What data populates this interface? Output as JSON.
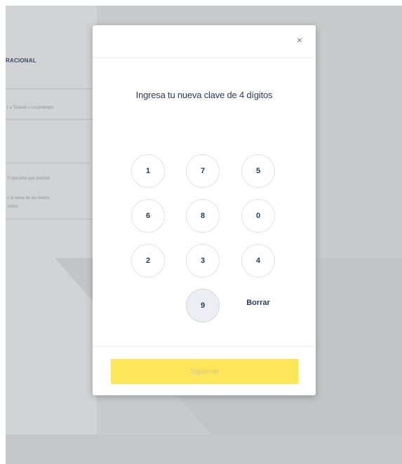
{
  "background": {
    "title": "RACIONAL",
    "subtitle": "",
    "line1": "r a Tisanal o cocumentos",
    "line2": "Ti porsona que precise",
    "line3": "s la tarea de las banco",
    "line4": "ssitus"
  },
  "modal": {
    "close_icon": "close-icon",
    "close_glyph": "×",
    "title": "Ingresa tu nueva clave de 4 dígitos",
    "keypad": {
      "rows": [
        [
          "1",
          "7",
          "5"
        ],
        [
          "6",
          "8",
          "0"
        ],
        [
          "2",
          "3",
          "4"
        ]
      ],
      "last_key": "9",
      "delete_label": "Borrar"
    },
    "continue_label": "Siguiente"
  },
  "colors": {
    "accent_yellow": "#fde659",
    "text_navy": "#2a3a5c",
    "overlay_gray": "#c9cacc"
  }
}
